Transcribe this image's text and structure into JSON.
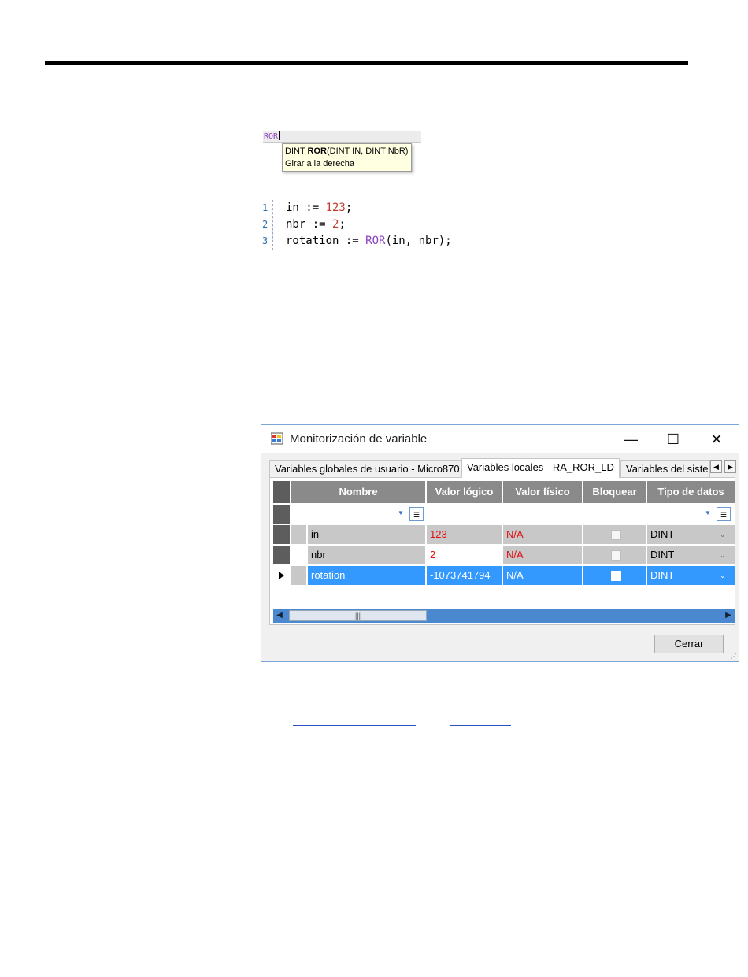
{
  "autocomplete": {
    "typed": "ROR",
    "tooltip_prefix": "DINT ",
    "tooltip_fn": "ROR",
    "tooltip_params": "(DINT IN, DINT NbR)",
    "tooltip_desc": "Girar a la derecha"
  },
  "code": [
    {
      "num": "1",
      "a": "in := ",
      "b": "123",
      "c": ";"
    },
    {
      "num": "2",
      "a": "nbr := ",
      "b": "2",
      "c": ";"
    },
    {
      "num": "3",
      "a": "rotation := ",
      "b": "ROR",
      "c": "(in, nbr);"
    }
  ],
  "dialog": {
    "title": "Monitorización de variable",
    "minimize_glyph": "—",
    "maximize_glyph": "☐",
    "close_glyph": "✕",
    "tabs": [
      "Variables globales de usuario - Micro870",
      "Variables locales - RA_ROR_LD",
      "Variables del sistema"
    ],
    "active_tab": 1,
    "columns": [
      "Nombre",
      "Valor lógico",
      "Valor físico",
      "Bloquear",
      "Tipo de datos"
    ],
    "rows": [
      {
        "name": "in",
        "logical": "123",
        "physical": "N/A",
        "locked": false,
        "type": "DINT"
      },
      {
        "name": "nbr",
        "logical": "2",
        "physical": "N/A",
        "locked": false,
        "type": "DINT"
      },
      {
        "name": "rotation",
        "logical": "-1073741794",
        "physical": "N/A",
        "locked": false,
        "type": "DINT"
      }
    ],
    "selected_row": 2,
    "close_button": "Cerrar"
  },
  "colors": {
    "keyword": "#8c3fc0",
    "number": "#c0392b",
    "selection": "#3399ff",
    "value_red": "#e01010"
  }
}
